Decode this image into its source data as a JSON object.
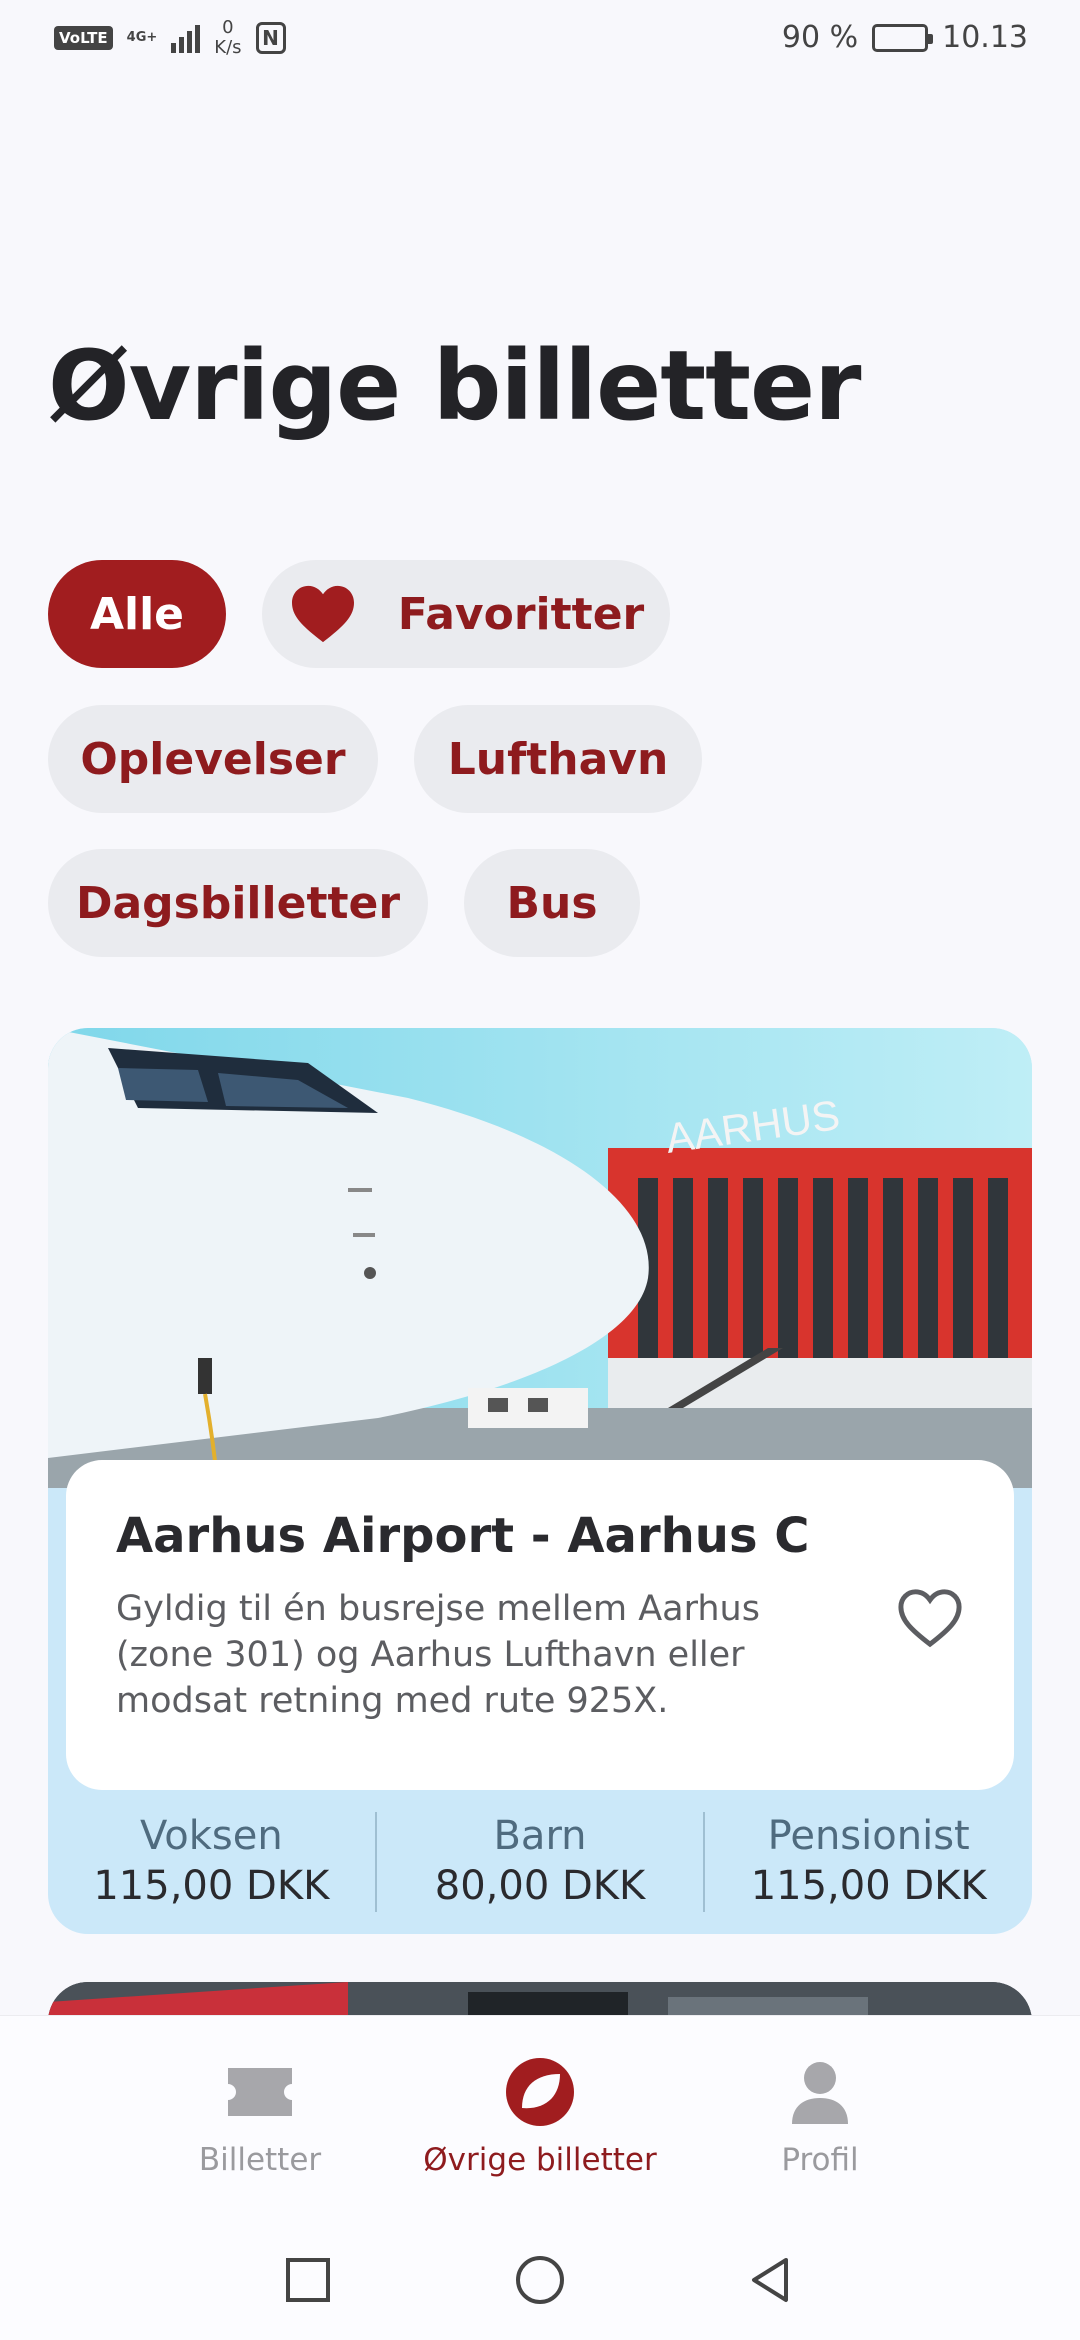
{
  "status_bar": {
    "volte": "VoLTE",
    "network": "4G+",
    "speed_value": "0",
    "speed_unit": "K/s",
    "battery_percent": "90 %",
    "battery_level": 0.9,
    "time": "10.13"
  },
  "page": {
    "title": "Øvrige billetter"
  },
  "filters": [
    {
      "label": "Alle",
      "active": true
    },
    {
      "label": "Favoritter",
      "icon": "heart-icon",
      "active": false
    },
    {
      "label": "Oplevelser",
      "active": false
    },
    {
      "label": "Lufthavn",
      "active": false
    },
    {
      "label": "Dagsbilletter",
      "active": false
    },
    {
      "label": "Bus",
      "active": false
    }
  ],
  "ticket_card": {
    "image_sign": "AARHUS",
    "title": "Aarhus Airport - Aarhus C",
    "description": "Gyldig til én busrejse mellem Aarhus (zone 301) og Aarhus Lufthavn eller modsat retning med rute 925X.",
    "favorite_icon": "heart-outline-icon",
    "prices": [
      {
        "label": "Voksen",
        "value": "115,00 DKK"
      },
      {
        "label": "Barn",
        "value": "80,00 DKK"
      },
      {
        "label": "Pensionist",
        "value": "115,00 DKK"
      }
    ]
  },
  "bottom_nav": [
    {
      "label": "Billetter",
      "icon": "ticket-icon",
      "active": false
    },
    {
      "label": "Øvrige billetter",
      "icon": "leaf-ticket-icon",
      "active": true
    },
    {
      "label": "Profil",
      "icon": "person-icon",
      "active": false
    }
  ],
  "colors": {
    "brand_red": "#a11d1f",
    "brand_red_text": "#8e1b1e",
    "chip_bg": "#eaebef",
    "card_bg": "#cbe8f9"
  }
}
